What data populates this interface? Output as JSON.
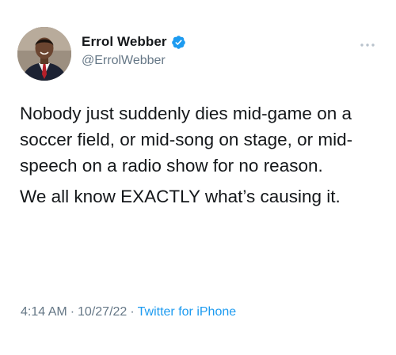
{
  "author": {
    "display_name": "Errol Webber",
    "handle": "@ErrolWebber",
    "verified": true
  },
  "tweet": {
    "paragraphs": [
      "Nobody just suddenly dies mid-game on a soccer field, or mid-song on stage, or mid-speech on a radio show for no reason.",
      "We all know EXACTLY what’s causing it."
    ]
  },
  "meta": {
    "time": "4:14 AM",
    "separator": "·",
    "date": "10/27/22",
    "source": "Twitter for iPhone"
  },
  "colors": {
    "verified": "#1d9bf0",
    "secondary_text": "#657786",
    "link": "#1d9bf0"
  },
  "icons": {
    "verified": "verified-badge-icon",
    "more": "more-options-icon"
  }
}
